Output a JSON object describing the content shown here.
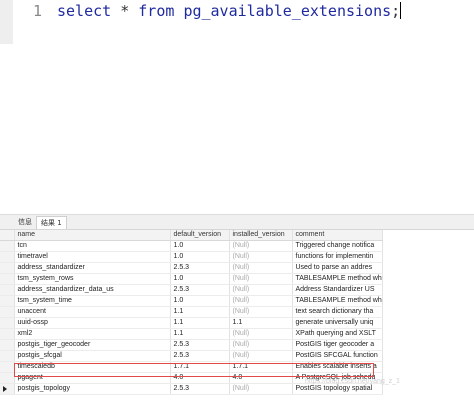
{
  "editor": {
    "line_number": "1",
    "keyword_select": "select",
    "star": "*",
    "keyword_from": "from",
    "table_name": "pg_available_extensions",
    "semicolon": ";"
  },
  "tabs": {
    "info": "信息",
    "result": "结果 1"
  },
  "grid": {
    "columns": [
      "name",
      "default_version",
      "installed_version",
      "comment"
    ],
    "rows": [
      [
        "tcn",
        "1.0",
        "(Null)",
        "Triggered change notifica"
      ],
      [
        "timetravel",
        "1.0",
        "(Null)",
        "functions for implementin"
      ],
      [
        "address_standardizer",
        "2.5.3",
        "(Null)",
        "Used to parse an addres"
      ],
      [
        "tsm_system_rows",
        "1.0",
        "(Null)",
        "TABLESAMPLE method wh"
      ],
      [
        "address_standardizer_data_us",
        "2.5.3",
        "(Null)",
        "Address Standardizer US"
      ],
      [
        "tsm_system_time",
        "1.0",
        "(Null)",
        "TABLESAMPLE method wh"
      ],
      [
        "unaccent",
        "1.1",
        "(Null)",
        "text search dictionary tha"
      ],
      [
        "uuid-ossp",
        "1.1",
        "1.1",
        "generate universally uniq"
      ],
      [
        "xml2",
        "1.1",
        "(Null)",
        "XPath querying and XSLT"
      ],
      [
        "postgis_tiger_geocoder",
        "2.5.3",
        "(Null)",
        "PostGIS tiger geocoder a"
      ],
      [
        "postgis_sfcgal",
        "2.5.3",
        "(Null)",
        "PostGIS SFCGAL function"
      ],
      [
        "timescaledb",
        "1.7.1",
        "1.7.1",
        "Enables scalable inserts a"
      ],
      [
        "pgagent",
        "4.0",
        "4.0",
        "A PostgreSQL job schedu"
      ],
      [
        "postgis_topology",
        "2.5.3",
        "(Null)",
        "PostGIS topology spatial"
      ]
    ],
    "current_row_index": 13,
    "highlight_row_index": 11
  },
  "watermark": "https://blog.csdn.net/yang_z_1",
  "colors": {
    "keyword": "#1f2aa0",
    "highlight_border": "#e24a4a",
    "null_text": "#a9a9a9"
  }
}
